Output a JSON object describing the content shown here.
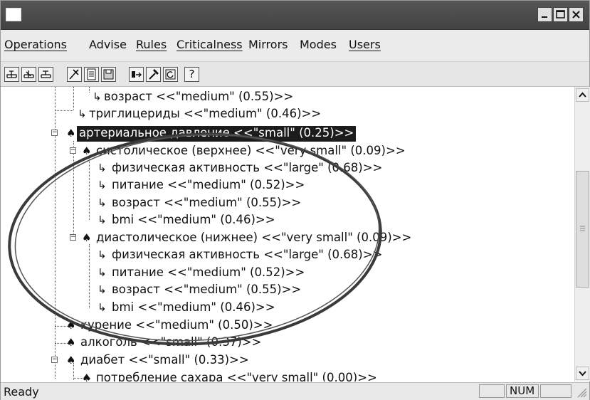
{
  "window": {
    "title": ""
  },
  "menu": [
    {
      "label": "Operations"
    },
    {
      "label": "Advise"
    },
    {
      "label": "Rules"
    },
    {
      "label": "Criticalness"
    },
    {
      "label": "Mirrors"
    },
    {
      "label": "Modes"
    },
    {
      "label": "Users"
    }
  ],
  "toolbar": {
    "icons": [
      "tree-collapse-icon",
      "tree-expand-icon",
      "tree-node-icon",
      "tools-icon",
      "document-icon",
      "save-icon",
      "move-icon",
      "hammer-icon",
      "refresh-icon",
      "help-icon"
    ],
    "help_label": "?"
  },
  "tree": {
    "nodes": [
      {
        "text": "возраст <<\"medium\" (0.55)>>"
      },
      {
        "text": "триглицериды <<\"medium\" (0.46)>>"
      },
      {
        "text": "артериальное давление <<\"small\" (0.25)>>"
      },
      {
        "text": "систолическое (верхнее) <<\"very small\" (0.09)>>"
      },
      {
        "text": "физическая активность <<\"large\" (0.68)>>"
      },
      {
        "text": "питание <<\"medium\" (0.52)>>"
      },
      {
        "text": "возраст <<\"medium\" (0.55)>>"
      },
      {
        "text": "bmi <<\"medium\" (0.46)>>"
      },
      {
        "text": "диастолическое (нижнее) <<\"very small\" (0.09)>>"
      },
      {
        "text": "физическая активность <<\"large\" (0.68)>>"
      },
      {
        "text": "питание <<\"medium\" (0.52)>>"
      },
      {
        "text": "возраст <<\"medium\" (0.55)>>"
      },
      {
        "text": "bmi <<\"medium\" (0.46)>>"
      },
      {
        "text": "курение <<\"medium\" (0.50)>>"
      },
      {
        "text": "алкоголь <<\"small\" (0.37)>>"
      },
      {
        "text": "диабет <<\"small\" (0.33)>>"
      },
      {
        "text": "потребление сахара <<\"very small\" (0.00)>>"
      }
    ],
    "selected_index": 2
  },
  "status": {
    "text": "Ready",
    "num": "NUM"
  },
  "colors": {
    "titlebar": "#4a4a4a",
    "selection": "#1c1c1c",
    "annotation": "#3a3a3a"
  }
}
